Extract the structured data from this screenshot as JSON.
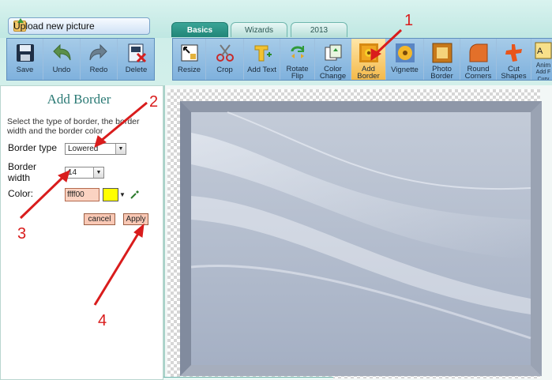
{
  "top": {
    "upload_label": "Upload new picture"
  },
  "tabs": [
    {
      "label": "Basics",
      "active": true
    },
    {
      "label": "Wizards",
      "active": false
    },
    {
      "label": "2013",
      "active": false
    }
  ],
  "file_toolbar": [
    {
      "label": "Save",
      "icon": "floppy-disk-icon"
    },
    {
      "label": "Undo",
      "icon": "undo-arrow-icon"
    },
    {
      "label": "Redo",
      "icon": "redo-arrow-icon"
    },
    {
      "label": "Delete",
      "icon": "delete-icon"
    }
  ],
  "tools": [
    {
      "line1": "Resize",
      "line2": "",
      "icon": "resize-icon"
    },
    {
      "line1": "Crop",
      "line2": "",
      "icon": "scissors-icon"
    },
    {
      "line1": "Add Text",
      "line2": "",
      "icon": "text-icon"
    },
    {
      "line1": "Rotate",
      "line2": "Flip",
      "icon": "rotate-icon"
    },
    {
      "line1": "Color",
      "line2": "Change",
      "icon": "color-change-icon"
    },
    {
      "line1": "Add",
      "line2": "Border",
      "icon": "add-border-icon",
      "selected": true
    },
    {
      "line1": "Vignette",
      "line2": "",
      "icon": "vignette-icon"
    },
    {
      "line1": "Photo",
      "line2": "Border",
      "icon": "photo-border-icon"
    },
    {
      "line1": "Round",
      "line2": "Corners",
      "icon": "round-corners-icon"
    },
    {
      "line1": "Cut",
      "line2": "Shapes",
      "icon": "cut-shapes-icon"
    },
    {
      "line1": "Anim",
      "line2": "Add F Curv",
      "icon": "animation-icon"
    }
  ],
  "panel": {
    "title": "Add Border",
    "description": "Select the type of border, the border width and the border color",
    "border_type_label": "Border type",
    "border_type_value": "Lowered",
    "border_width_label_1": "Border",
    "border_width_label_2": "width",
    "border_width_value": "14",
    "color_label": "Color:",
    "color_value": "ffff00",
    "color_swatch": "#ffff00",
    "cancel_label": "cancel",
    "apply_label": "Apply"
  },
  "annotations": {
    "n1": "1",
    "n2": "2",
    "n3": "3",
    "n4": "4",
    "color": "#d91c1c"
  },
  "colors": {
    "accent": "#218577",
    "toolbar": "#8fbde3",
    "selected_tool": "#f4b94a"
  }
}
